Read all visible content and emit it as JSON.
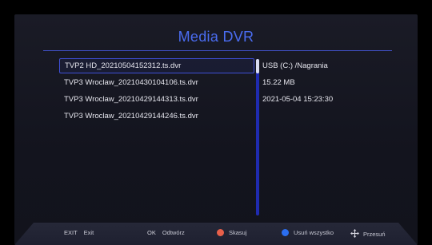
{
  "header": {
    "title": "Media DVR"
  },
  "files": [
    "TVP2 HD_20210504152312.ts.dvr",
    "TVP3 Wroclaw_20210430104106.ts.dvr",
    "TVP3 Wroclaw_20210429144313.ts.dvr",
    "TVP3 Wroclaw_20210429144246.ts.dvr"
  ],
  "selected_index": 0,
  "info": {
    "path": "USB (C:) /Nagrania",
    "size": "15.22 MB",
    "datetime": "2021-05-04 15:23:30"
  },
  "footer": {
    "exit_key": "EXIT",
    "exit_label": "Exit",
    "ok_key": "OK",
    "ok_label": "Odtwórz",
    "delete_label": "Skasuj",
    "delete_all_label": "Usuń wszystko",
    "move_label": "Przesuń"
  },
  "colors": {
    "accent": "#4a6cf0",
    "red_button": "#e8604a",
    "blue_button": "#2b6ef0"
  }
}
